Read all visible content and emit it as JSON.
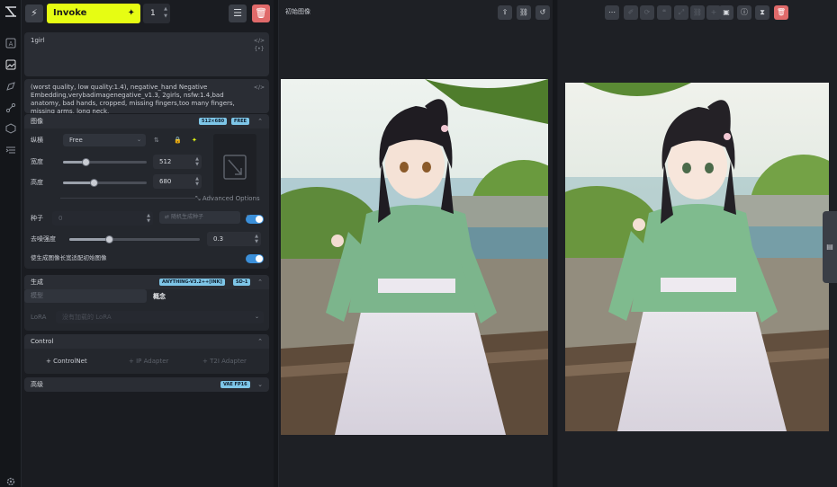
{
  "toolbar": {
    "invoke_label": "Invoke",
    "iterations": "1"
  },
  "prompts": {
    "positive": "1girl",
    "negative": "(worst quality, low quality:1.4), negative_hand Negative Embedding,verybadimagenegative_v1.3, 2girls, nsfw:1.4,bad anatomy, bad hands, cropped, missing fingers,too many fingers, missing arms, long neck,"
  },
  "image_section": {
    "title": "图像",
    "badge_size": "512×680",
    "badge_free": "FREE",
    "aspect_label": "纵横",
    "aspect_value": "Free",
    "width_label": "宽度",
    "width_value": "512",
    "width_fraction": 0.27,
    "height_label": "高度",
    "height_value": "680",
    "height_fraction": 0.37,
    "advanced_label": "Advanced Options",
    "seed_label": "种子",
    "seed_value": "0",
    "random_seed_button": "随机生成种子",
    "random_label": "随机",
    "denoise_label": "去噪强度",
    "denoise_value": "0.3",
    "denoise_fraction": 0.3,
    "fit_label": "使生成图像长宽适配初始图像"
  },
  "generation_section": {
    "title": "生成",
    "badge_model": "ANYTHING-V3.2++[INK]",
    "badge_sd": "SD-1",
    "model_label": "模型",
    "concept_label": "概念",
    "lora_label": "LoRA",
    "lora_placeholder": "没有加载的 LoRA"
  },
  "control_section": {
    "title": "Control",
    "controlnet": "ControlNet",
    "ip_adapter": "IP Adapter",
    "t2i_adapter": "T2I Adapter"
  },
  "advanced_section": {
    "title": "高级",
    "badge": "VAE FP16"
  },
  "center_panel": {
    "title": "初始图像"
  },
  "colors": {
    "accent": "#e6fd13",
    "toggle": "#3b8fd9",
    "danger": "#e06a6a",
    "badge": "#7ec6e8"
  }
}
